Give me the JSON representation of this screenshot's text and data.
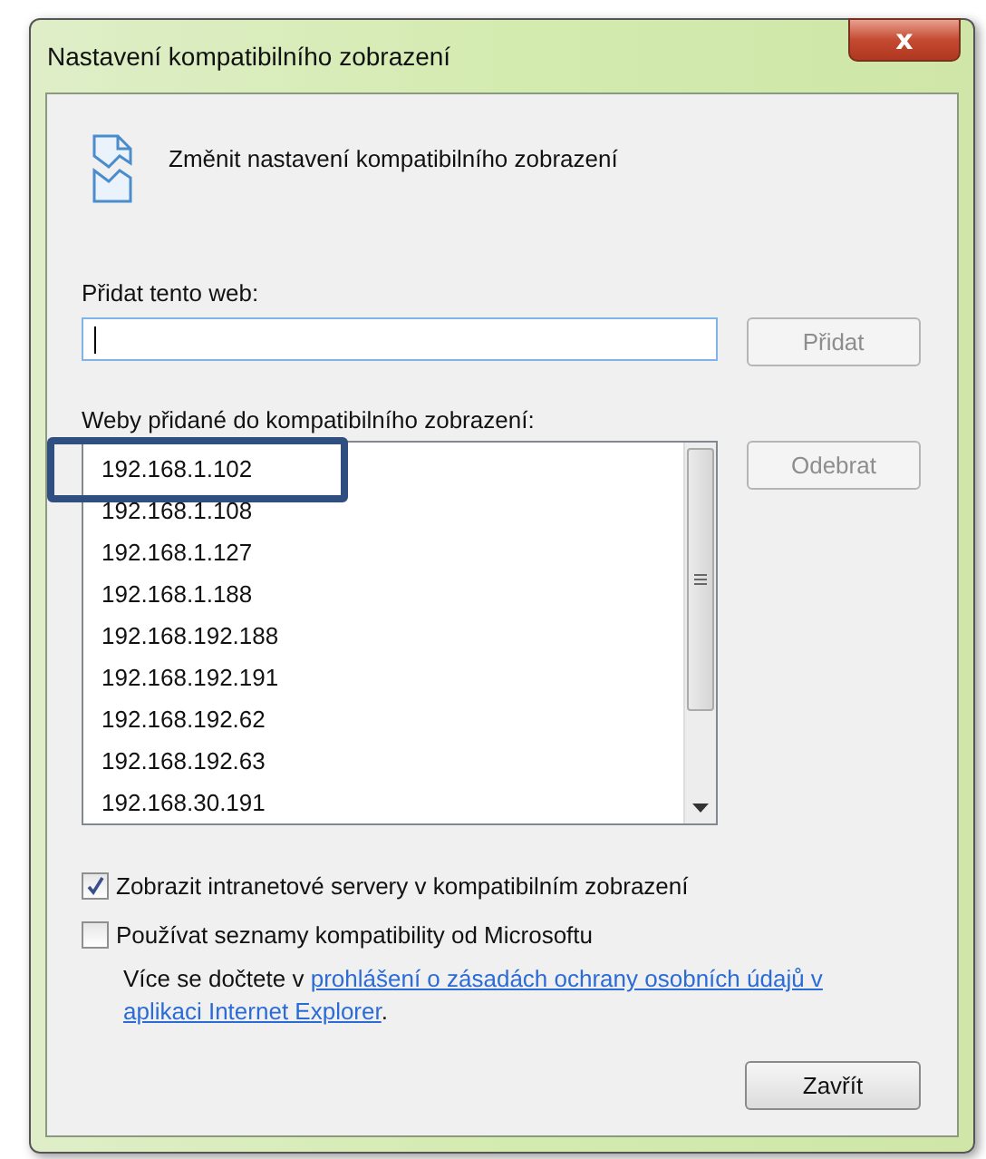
{
  "window": {
    "title": "Nastavení kompatibilního zobrazení",
    "close": "x"
  },
  "heading": "Změnit nastavení kompatibilního zobrazení",
  "add_site": {
    "label": "Přidat tento web:",
    "button": {
      "label": "Přidat",
      "disabled": true
    }
  },
  "sites": {
    "label": "Weby přidané do kompatibilního zobrazení:",
    "button": {
      "label": "Odebrat",
      "disabled": true
    },
    "items": [
      {
        "text": "192.168.1.102",
        "highlighted": true
      },
      {
        "text": "192.168.1.108",
        "highlighted": false
      },
      {
        "text": "192.168.1.127",
        "highlighted": false
      },
      {
        "text": "192.168.1.188",
        "highlighted": false
      },
      {
        "text": "192.168.192.188",
        "highlighted": false
      },
      {
        "text": "192.168.192.191",
        "highlighted": false
      },
      {
        "text": "192.168.192.62",
        "highlighted": false
      },
      {
        "text": "192.168.192.63",
        "highlighted": false
      },
      {
        "text": "192.168.30.191",
        "highlighted": false
      }
    ]
  },
  "options": [
    {
      "label": "Zobrazit intranetové servery v kompatibilním zobrazení",
      "checked": true
    },
    {
      "label": "Používat seznamy kompatibility od Microsoftu",
      "checked": false
    }
  ],
  "info": {
    "text": "Více se dočtete v ",
    "link": [
      "prohlášení o zásadách ochrany osobních údajů v",
      "aplikaci Internet Explorer"
    ],
    "after": "."
  },
  "close_button": "Zavřít"
}
